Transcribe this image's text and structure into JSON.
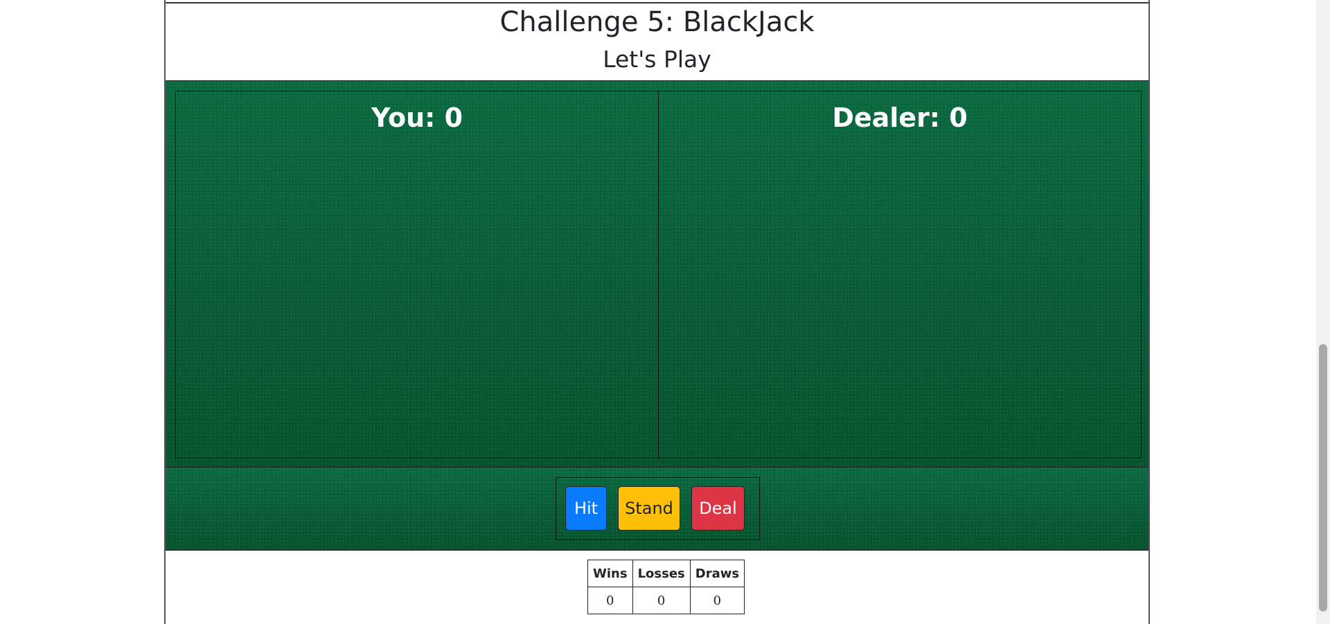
{
  "header": {
    "title": "Challenge 5: BlackJack",
    "subtitle": "Let's Play"
  },
  "board": {
    "you_label": "You: ",
    "you_score": "0",
    "dealer_label": "Dealer: ",
    "dealer_score": "0"
  },
  "controls": {
    "hit_label": "Hit",
    "stand_label": "Stand",
    "deal_label": "Deal"
  },
  "results": {
    "headers": [
      "Wins",
      "Losses",
      "Draws"
    ],
    "values": [
      "0",
      "0",
      "0"
    ]
  },
  "colors": {
    "felt": "#06603a",
    "hit": "#0a7bff",
    "stand": "#ffc107",
    "deal": "#dc3545"
  }
}
